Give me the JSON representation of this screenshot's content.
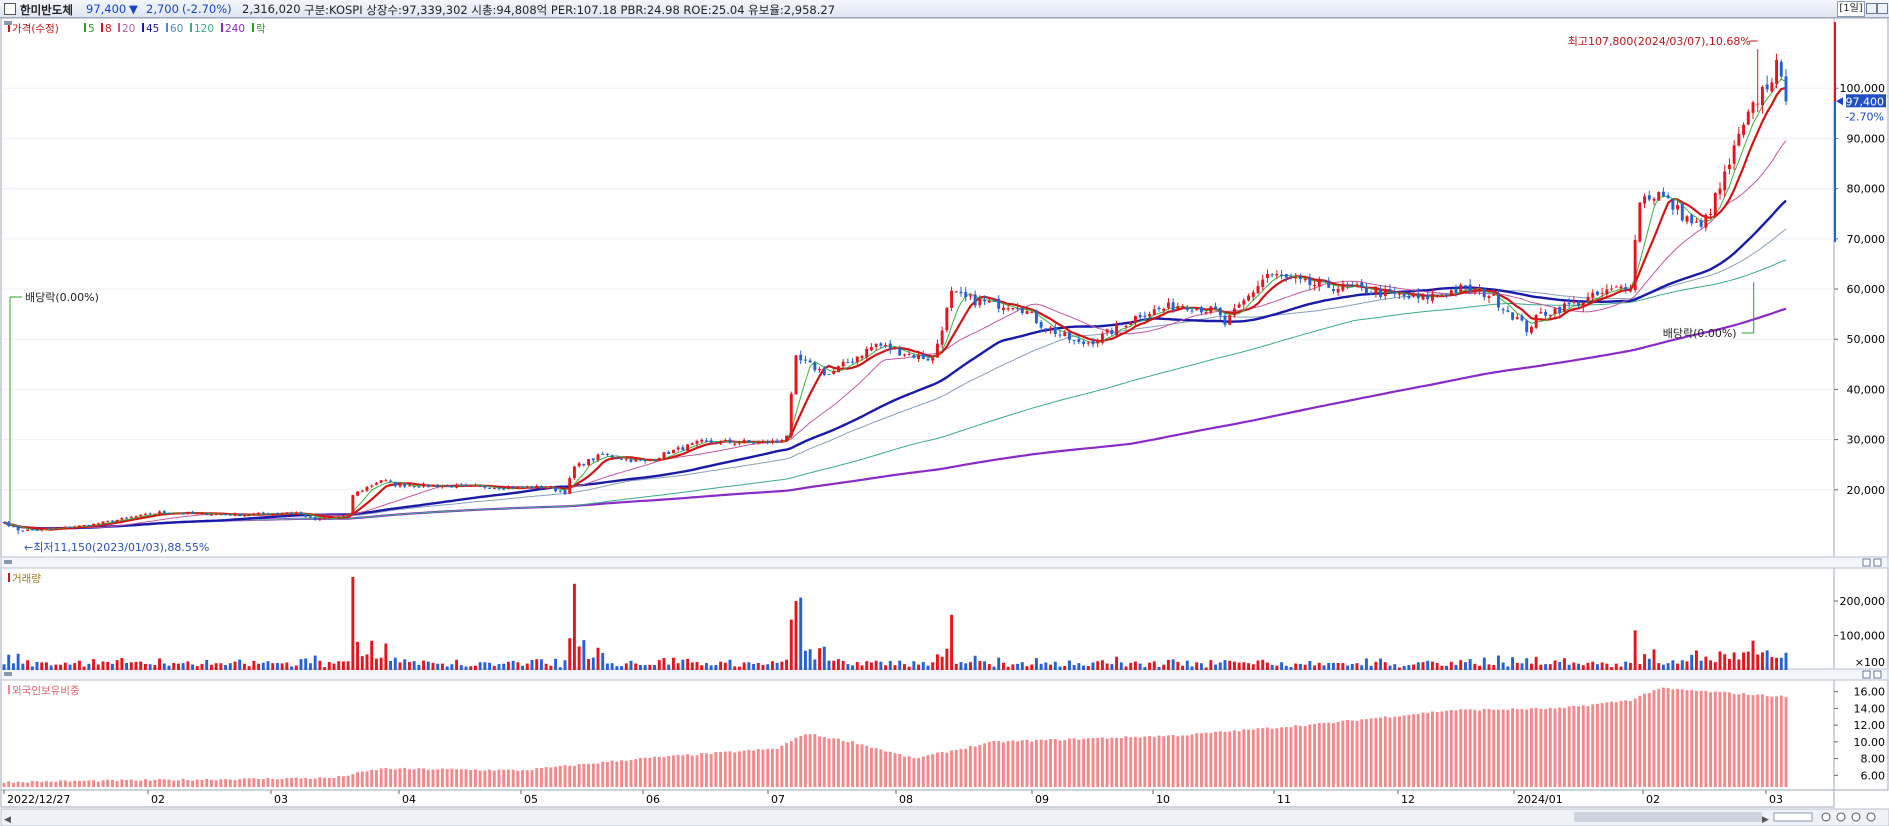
{
  "header": {
    "stock_name": "한미반도체",
    "price": "97,400",
    "change_arrow": "▼",
    "change": "2,700",
    "change_pct": "(-2.70%)",
    "volume": "2,316,020",
    "info": "구분:KOSPI 상장수:97,339,302 시총:94,808억 PER:107.18 PBR:24.98 ROE:25.04 유보율:2,958.27",
    "period_button": "[1일]"
  },
  "colors": {
    "up": "#e8141b",
    "down": "#2461d6",
    "ma5": "#3cb043",
    "ma8": "#d01616",
    "ma20": "#c05aa0",
    "ma45": "#1a1aa8",
    "ma60": "#8aa0b8",
    "ma120": "#3caa8a",
    "ma240": "#8a2bc8",
    "foreign": "#f4898c"
  },
  "price_panel": {
    "legend": [
      {
        "label": "가격(수정)",
        "color": "#d01616"
      },
      {
        "label": "5",
        "color": "#2ca02c"
      },
      {
        "label": "8",
        "color": "#d01616"
      },
      {
        "label": "20",
        "color": "#c05aa0"
      },
      {
        "label": "45",
        "color": "#1a1aa8"
      },
      {
        "label": "60",
        "color": "#4a88c8"
      },
      {
        "label": "120",
        "color": "#3caa8a"
      },
      {
        "label": "240",
        "color": "#8a2bc8"
      },
      {
        "label": "락",
        "color": "#2ca02c"
      }
    ],
    "high_note": "최고107,800(2024/03/07),10.68%",
    "low_note": "최저11,150(2023/01/03),88.55%",
    "dividend_note_left": "배당락(0.00%)",
    "dividend_note_right": "배당락(0.00%)",
    "current_price_tag": "97,400",
    "current_change_tag": "-2.70%",
    "y_ticks": [
      "100,000",
      "90,000",
      "80,000",
      "70,000",
      "60,000",
      "50,000",
      "40,000",
      "30,000",
      "20,000"
    ]
  },
  "volume_panel": {
    "legend": "거래량",
    "y_ticks": [
      "200,000",
      "100,000",
      "×100"
    ]
  },
  "foreign_panel": {
    "legend": "외국인보유비중",
    "y_ticks": [
      "16.00",
      "14.00",
      "12.00",
      "10.00",
      "8.00",
      "6.00"
    ]
  },
  "x_axis": {
    "labels": [
      "2022/12/27",
      "02",
      "03",
      "04",
      "05",
      "06",
      "07",
      "08",
      "09",
      "10",
      "11",
      "12",
      "2024/01",
      "02",
      "03"
    ]
  },
  "chart_data": {
    "type": "candlestick",
    "title": "한미반도체",
    "period": "daily",
    "x_range": [
      "2022/12/27",
      "2024/03/08"
    ],
    "ylim_price": [
      10000,
      112000
    ],
    "price_anchors": [
      {
        "t": 0,
        "close": 13500
      },
      {
        "t": 3,
        "close": 12000
      },
      {
        "t": 7,
        "close": 12000
      },
      {
        "t": 18,
        "close": 13000
      },
      {
        "t": 33,
        "close": 15500
      },
      {
        "t": 50,
        "close": 15000
      },
      {
        "t": 62,
        "close": 15500
      },
      {
        "t": 66,
        "close": 14000
      },
      {
        "t": 73,
        "close": 15000
      },
      {
        "t": 74,
        "close": 19000
      },
      {
        "t": 80,
        "close": 22000
      },
      {
        "t": 83,
        "close": 21000
      },
      {
        "t": 105,
        "close": 20500
      },
      {
        "t": 115,
        "close": 20500
      },
      {
        "t": 119,
        "close": 19500
      },
      {
        "t": 121,
        "close": 24500
      },
      {
        "t": 127,
        "close": 27000
      },
      {
        "t": 136,
        "close": 25500
      },
      {
        "t": 141,
        "close": 27500
      },
      {
        "t": 148,
        "close": 29500
      },
      {
        "t": 164,
        "close": 29500
      },
      {
        "t": 166,
        "close": 31000
      },
      {
        "t": 168,
        "close": 46000
      },
      {
        "t": 175,
        "close": 43000
      },
      {
        "t": 185,
        "close": 49000
      },
      {
        "t": 192,
        "close": 47000
      },
      {
        "t": 197,
        "close": 46000
      },
      {
        "t": 201,
        "close": 59000
      },
      {
        "t": 204,
        "close": 58000
      },
      {
        "t": 210,
        "close": 57000
      },
      {
        "t": 215,
        "close": 57000
      },
      {
        "t": 220,
        "close": 53000
      },
      {
        "t": 228,
        "close": 49000
      },
      {
        "t": 232,
        "close": 50000
      },
      {
        "t": 241,
        "close": 55000
      },
      {
        "t": 250,
        "close": 57000
      },
      {
        "t": 257,
        "close": 55500
      },
      {
        "t": 259,
        "close": 53000
      },
      {
        "t": 268,
        "close": 63000
      },
      {
        "t": 276,
        "close": 61000
      },
      {
        "t": 287,
        "close": 60000
      },
      {
        "t": 300,
        "close": 58000
      },
      {
        "t": 309,
        "close": 60000
      },
      {
        "t": 315,
        "close": 59000
      },
      {
        "t": 321,
        "close": 54000
      },
      {
        "t": 323,
        "close": 52000
      },
      {
        "t": 326,
        "close": 55000
      },
      {
        "t": 336,
        "close": 58000
      },
      {
        "t": 345,
        "close": 61000
      },
      {
        "t": 347,
        "close": 78000
      },
      {
        "t": 351,
        "close": 79000
      },
      {
        "t": 357,
        "close": 74000
      },
      {
        "t": 360,
        "close": 72000
      },
      {
        "t": 364,
        "close": 80000
      },
      {
        "t": 368,
        "close": 90000
      },
      {
        "t": 372,
        "close": 98000
      },
      {
        "t": 376,
        "close": 104000
      },
      {
        "t": 378,
        "close": 97400
      }
    ],
    "ma_overlays": [
      "5",
      "8",
      "20",
      "45",
      "60",
      "120",
      "240"
    ],
    "volume_spikes": [
      {
        "t": 74,
        "value": 270000
      },
      {
        "t": 121,
        "value": 250000
      },
      {
        "t": 168,
        "value": 200000
      },
      {
        "t": 169,
        "value": 210000
      },
      {
        "t": 201,
        "value": 160000
      },
      {
        "t": 346,
        "value": 115000
      },
      {
        "t": 371,
        "value": 85000
      }
    ],
    "foreign_ratio_anchors": [
      {
        "t": 0,
        "value": 5.2
      },
      {
        "t": 70,
        "value": 5.7
      },
      {
        "t": 80,
        "value": 6.8
      },
      {
        "t": 110,
        "value": 6.6
      },
      {
        "t": 135,
        "value": 8.0
      },
      {
        "t": 164,
        "value": 9.2
      },
      {
        "t": 170,
        "value": 11.0
      },
      {
        "t": 180,
        "value": 10.0
      },
      {
        "t": 193,
        "value": 8.0
      },
      {
        "t": 210,
        "value": 10.0
      },
      {
        "t": 250,
        "value": 10.8
      },
      {
        "t": 280,
        "value": 12.2
      },
      {
        "t": 307,
        "value": 13.8
      },
      {
        "t": 330,
        "value": 14.0
      },
      {
        "t": 345,
        "value": 15.0
      },
      {
        "t": 351,
        "value": 16.4
      },
      {
        "t": 378,
        "value": 15.4
      }
    ]
  }
}
